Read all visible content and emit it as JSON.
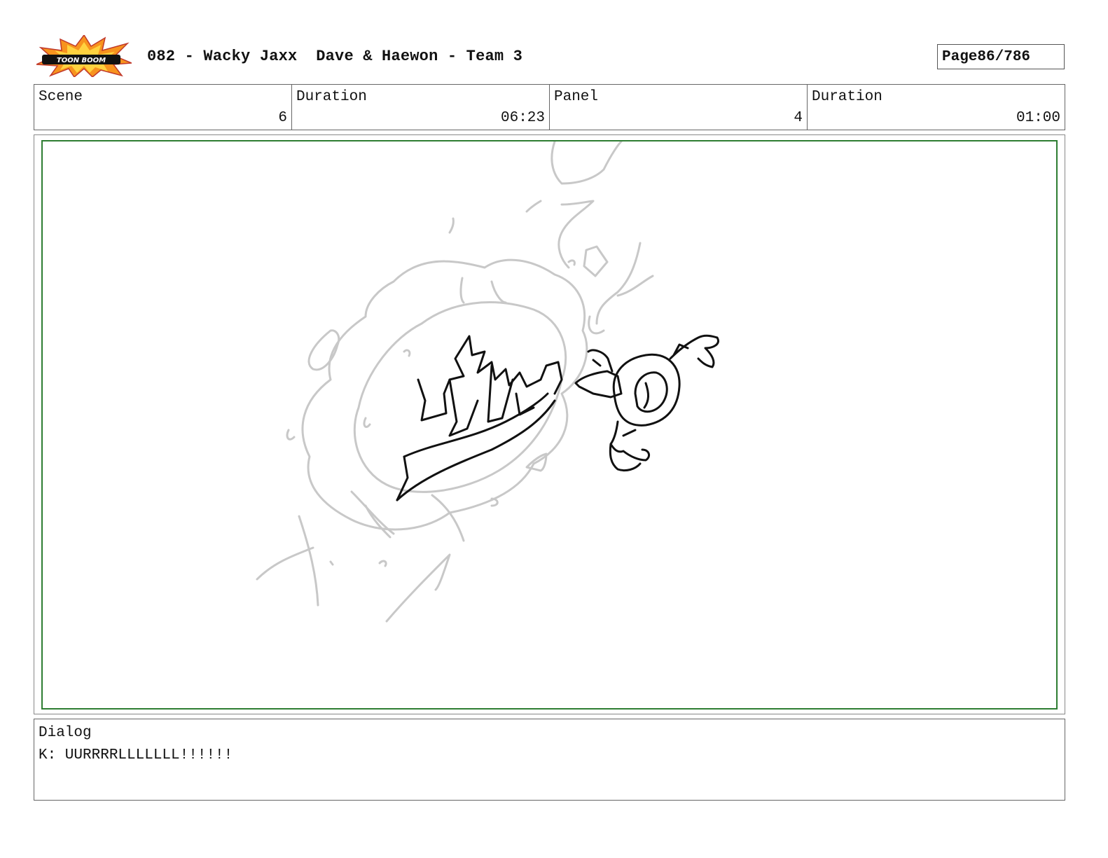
{
  "header": {
    "logo_text": "TOON BOOM",
    "title": "082 - Wacky Jaxx  Dave & Haewon - Team 3",
    "page_label": "Page",
    "page_value": "86/786"
  },
  "info": {
    "scene_label": "Scene",
    "scene_value": "6",
    "scene_duration_label": "Duration",
    "scene_duration_value": "06:23",
    "panel_label": "Panel",
    "panel_value": "4",
    "panel_duration_label": "Duration",
    "panel_duration_value": "01:00"
  },
  "dialog": {
    "label": "Dialog",
    "text": "K: UURRRRLLLLLLL!!!!!!"
  },
  "colors": {
    "panel_frame": "#2e7d32",
    "sketch_rough": "#c8c8c8",
    "sketch_ink": "#111111",
    "logo_burst": "#f7931e"
  }
}
